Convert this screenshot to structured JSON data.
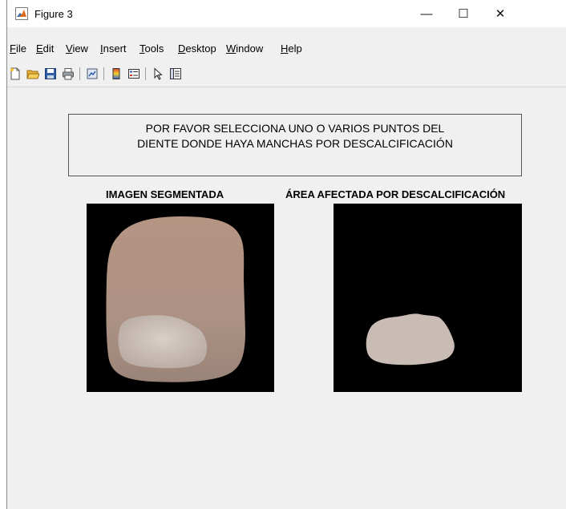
{
  "window": {
    "title": "Figure 3",
    "minimize_label": "—",
    "maximize_label": "☐",
    "close_label": "✕"
  },
  "menubar": {
    "items": [
      {
        "accel": "F",
        "rest": "ile"
      },
      {
        "accel": "E",
        "rest": "dit"
      },
      {
        "accel": "V",
        "rest": "iew"
      },
      {
        "accel": "I",
        "rest": "nsert"
      },
      {
        "accel": "T",
        "rest": "ools"
      },
      {
        "accel": "D",
        "rest": "esktop"
      },
      {
        "accel": "W",
        "rest": "indow"
      },
      {
        "accel": "H",
        "rest": "elp"
      }
    ]
  },
  "toolbar": {
    "icons": [
      "new-figure-icon",
      "open-file-icon",
      "save-icon",
      "print-icon",
      "link-plot-icon",
      "insert-colorbar-icon",
      "insert-legend-icon",
      "edit-plot-arrow-icon",
      "property-inspector-icon"
    ]
  },
  "message": {
    "line1": "POR FAVOR SELECCIONA UNO O VARIOS PUNTOS DEL",
    "line2": "DIENTE DONDE HAYA MANCHAS POR DESCALCIFICACIÓN"
  },
  "axes": {
    "left_title": "IMAGEN SEGMENTADA",
    "right_title": "ÁREA AFECTADA POR DESCALCIFICACIÓN"
  },
  "colors": {
    "tooth": "#b59482",
    "stain": "#c9bcb4",
    "background": "#f0f0f0",
    "image_bg": "#000000"
  }
}
